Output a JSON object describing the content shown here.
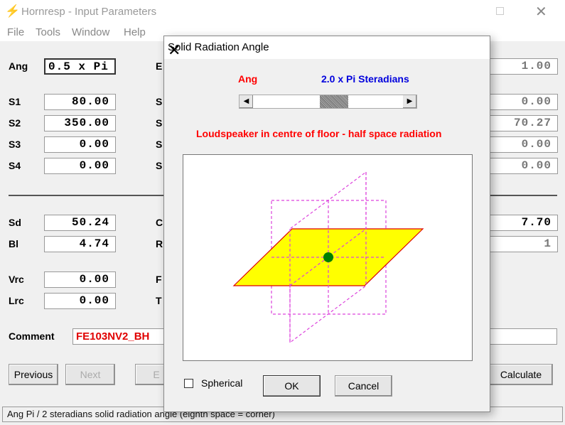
{
  "window": {
    "title": "Hornresp - Input Parameters",
    "icon": "lightning-icon"
  },
  "menu": [
    "File",
    "Tools",
    "Window",
    "Help"
  ],
  "left_fields": [
    {
      "label": "Ang",
      "value": "0.5 x Pi"
    },
    {
      "label": "S1",
      "value": "80.00"
    },
    {
      "label": "S2",
      "value": "350.00"
    },
    {
      "label": "S3",
      "value": "0.00"
    },
    {
      "label": "S4",
      "value": "0.00"
    },
    {
      "label": "Sd",
      "value": "50.24"
    },
    {
      "label": "Bl",
      "value": "4.74"
    },
    {
      "label": "Vrc",
      "value": "0.00"
    },
    {
      "label": "Lrc",
      "value": "0.00"
    }
  ],
  "middle_labels": [
    "E",
    "S",
    "S",
    "S",
    "S",
    "C",
    "R",
    "F",
    "T"
  ],
  "right_fields": [
    "1.00",
    "0.00",
    "70.27",
    "0.00",
    "0.00",
    "7.70",
    "1"
  ],
  "comment": {
    "label": "Comment",
    "value": "FE103NV2_BH"
  },
  "buttons": {
    "previous": "Previous",
    "next": "Next",
    "partial": "E",
    "calculate": "Calculate"
  },
  "status": "Ang   Pi / 2 steradians solid radiation angle  (eighth space = corner)",
  "dialog": {
    "title": "Solid Radiation Angle",
    "ang_label": "Ang",
    "value_label": "2.0 x Pi Steradians",
    "slider_position_percent": 55,
    "description": "Loudspeaker in centre of floor - half space radiation",
    "spherical_label": "Spherical",
    "spherical_checked": false,
    "ok": "OK",
    "cancel": "Cancel",
    "colors": {
      "red": "#ff0000",
      "blue": "#0000dd",
      "plane": "#ffff00",
      "guides": "#dd44dd",
      "speaker": "#008000"
    }
  }
}
